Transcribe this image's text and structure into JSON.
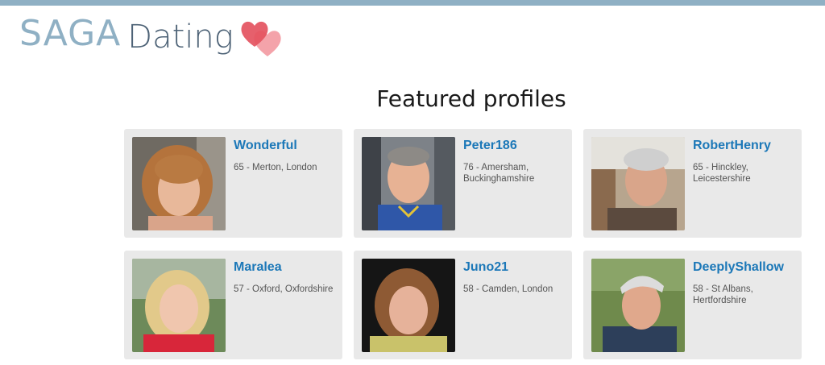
{
  "brand": {
    "saga": "SAGA",
    "dating": "Dating",
    "heart_color_front": "#e4525f",
    "heart_color_back": "#f4a3aa"
  },
  "section": {
    "title": "Featured profiles"
  },
  "colors": {
    "top_bar": "#8fb0c4",
    "card_bg": "#e9e9e9",
    "name_link": "#1c78b8"
  },
  "profiles": [
    {
      "name": "Wonderful",
      "details": "65 - Merton, London",
      "photo": "woman-auburn-hair-photo"
    },
    {
      "name": "Peter186",
      "details": "76 - Amersham, Buckinghamshire",
      "photo": "man-blue-shirt-photo"
    },
    {
      "name": "RobertHenry",
      "details": "65 - Hinckley, Leicestershire",
      "photo": "man-grey-hair-photo"
    },
    {
      "name": "Maralea",
      "details": "57 - Oxford, Oxfordshire",
      "photo": "woman-blonde-red-top-photo"
    },
    {
      "name": "Juno21",
      "details": "58 - Camden, London",
      "photo": "woman-brown-bob-photo"
    },
    {
      "name": "DeeplyShallow",
      "details": "58 - St Albans, Hertfordshire",
      "photo": "man-cycling-helmet-photo"
    }
  ]
}
